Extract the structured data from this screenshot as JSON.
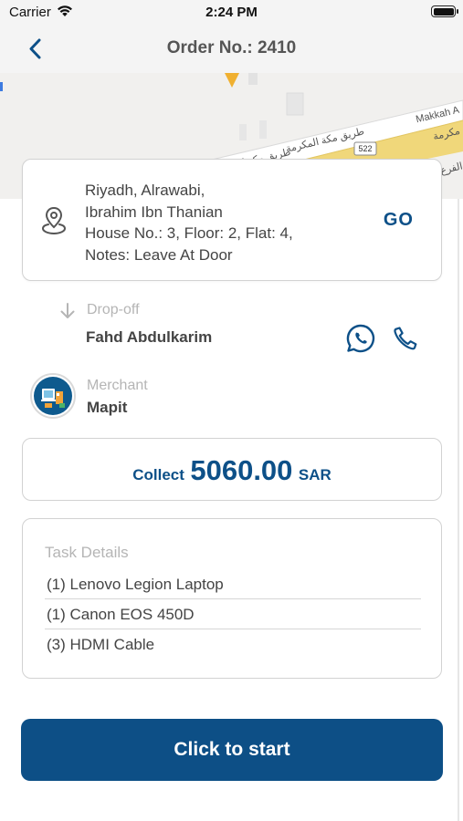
{
  "status_bar": {
    "carrier": "Carrier",
    "time": "2:24 PM"
  },
  "header": {
    "title": "Order No.: 2410"
  },
  "map": {
    "road_label_en": "Makkah A",
    "road_label_ar": "طريق مكة المكرمة",
    "road_label_ar_2": "مكرمة",
    "road_label_ar_3": "الفرع",
    "road_label_ar_4": "طريق مكة المك",
    "route_badge": "522"
  },
  "address": {
    "lines": [
      "Riyadh, Alrawabi,",
      "Ibrahim Ibn Thanian",
      "House No.: 3, Floor: 2, Flat: 4,",
      "Notes: Leave At Door"
    ],
    "go_label": "GO"
  },
  "dropoff": {
    "label": "Drop-off",
    "name": "Fahd Abdulkarim"
  },
  "merchant": {
    "label": "Merchant",
    "name": "Mapit"
  },
  "collect": {
    "label": "Collect",
    "amount": "5060.00",
    "currency": "SAR"
  },
  "task_details": {
    "heading": "Task Details",
    "items": [
      "(1) Lenovo Legion Laptop",
      "(1) Canon EOS 450D",
      "(3) HDMI Cable"
    ]
  },
  "start_button": {
    "label": "Click to start"
  },
  "colors": {
    "primary": "#0d5088",
    "button": "#0d4f86",
    "muted": "#b5b5b5",
    "text": "#444444",
    "map_road": "#f0d77a"
  }
}
